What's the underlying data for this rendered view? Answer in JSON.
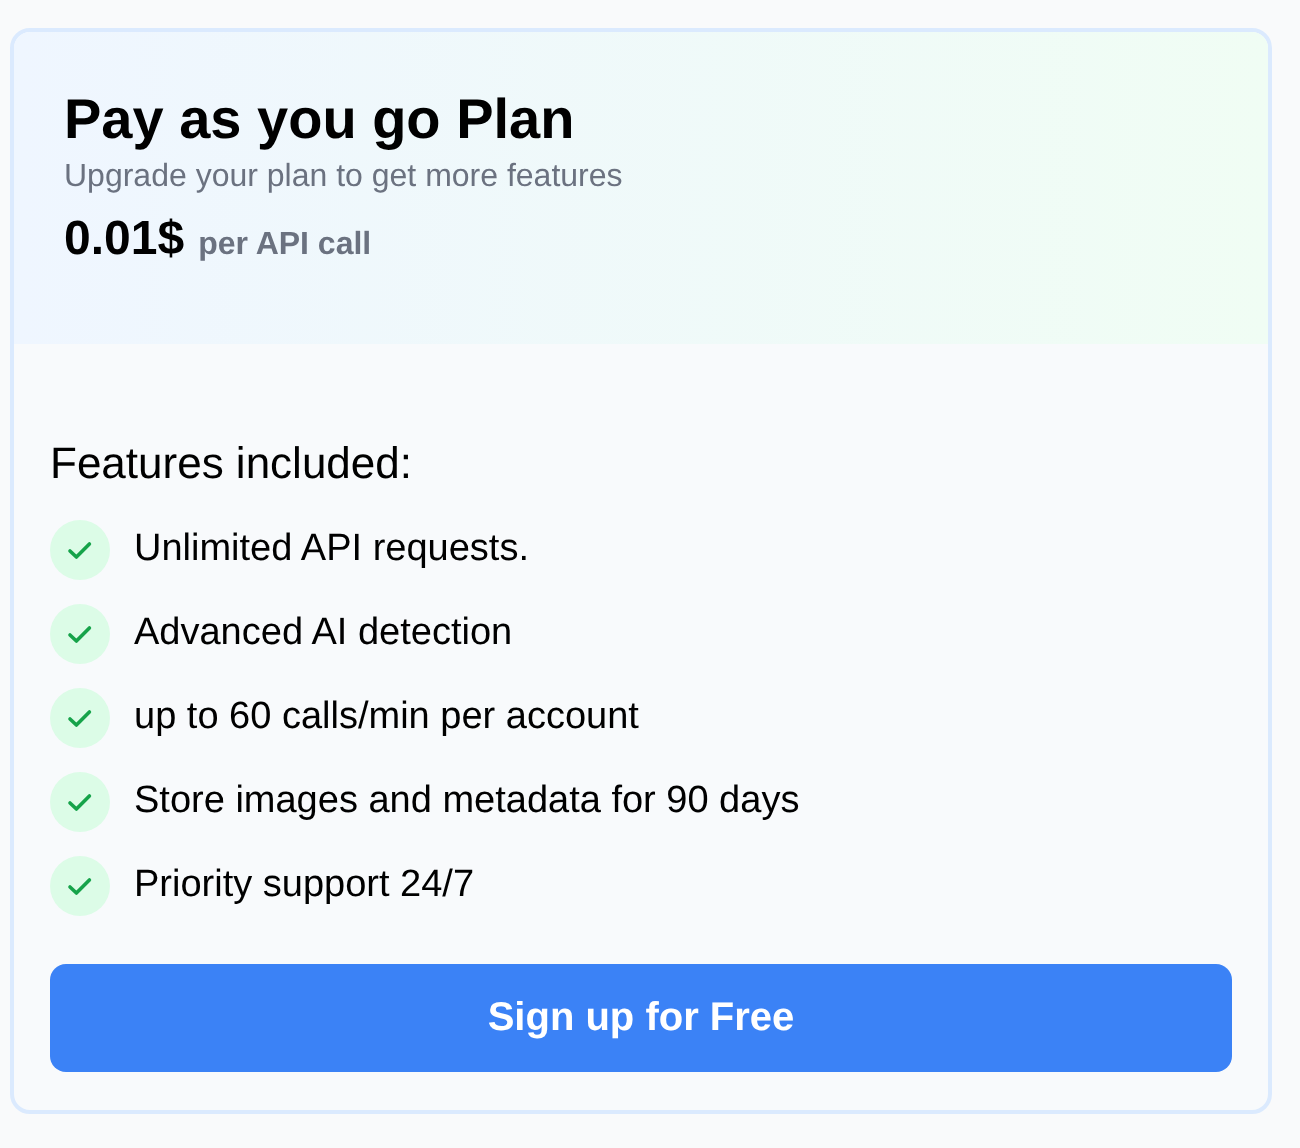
{
  "plan": {
    "title": "Pay as you go Plan",
    "subtitle": "Upgrade your plan to get more features",
    "price": "0.01$",
    "price_unit": "per API call"
  },
  "features_heading": "Features included:",
  "features": [
    {
      "label": "Unlimited API requests."
    },
    {
      "label": "Advanced AI detection"
    },
    {
      "label": "up to 60 calls/min per account"
    },
    {
      "label": "Store images and metadata for 90 days"
    },
    {
      "label": "Priority support 24/7"
    }
  ],
  "button": "Sign up for Free"
}
